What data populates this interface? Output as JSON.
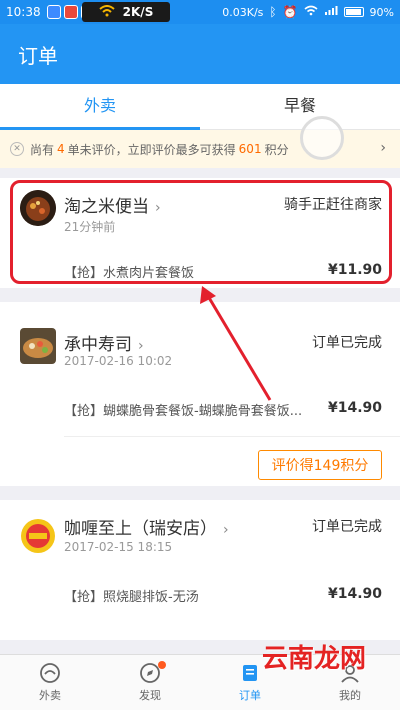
{
  "status_bar": {
    "time": "10:38",
    "net_speed_box": "2K/S",
    "speed": "0.03K/s",
    "battery": "90%"
  },
  "app_bar": {
    "title": "订单"
  },
  "tabs": [
    {
      "label": "外卖",
      "active": true
    },
    {
      "label": "早餐",
      "active": false
    }
  ],
  "notice": {
    "prefix": "尚有",
    "count": "4",
    "middle": "单未评价，立即评价最多可获得",
    "points": "601",
    "suffix": "积分"
  },
  "orders": [
    {
      "store": "淘之米便当",
      "time": "21分钟前",
      "status": "骑手正赶往商家",
      "item": "【抢】水煮肉片套餐饭",
      "price": "¥11.90"
    },
    {
      "store": "承中寿司",
      "time": "2017-02-16 10:02",
      "status": "订单已完成",
      "item": "【抢】蝴蝶脆骨套餐饭-蝴蝶脆骨套餐饭...",
      "price": "¥14.90",
      "review_button": "评价得149积分"
    },
    {
      "store": "咖喱至上（瑞安店）",
      "time": "2017-02-15 18:15",
      "status": "订单已完成",
      "item": "【抢】照烧腿排饭-无汤",
      "price": "¥14.90"
    }
  ],
  "bottom_nav": [
    {
      "label": "外卖",
      "icon": "takeout-icon"
    },
    {
      "label": "发现",
      "icon": "compass-icon"
    },
    {
      "label": "订单",
      "icon": "order-icon",
      "active": true
    },
    {
      "label": "我的",
      "icon": "profile-icon"
    }
  ],
  "watermark": "云南龙网",
  "colors": {
    "primary": "#2395f3",
    "accent": "#ff7a00",
    "annotation": "#e3202d"
  }
}
